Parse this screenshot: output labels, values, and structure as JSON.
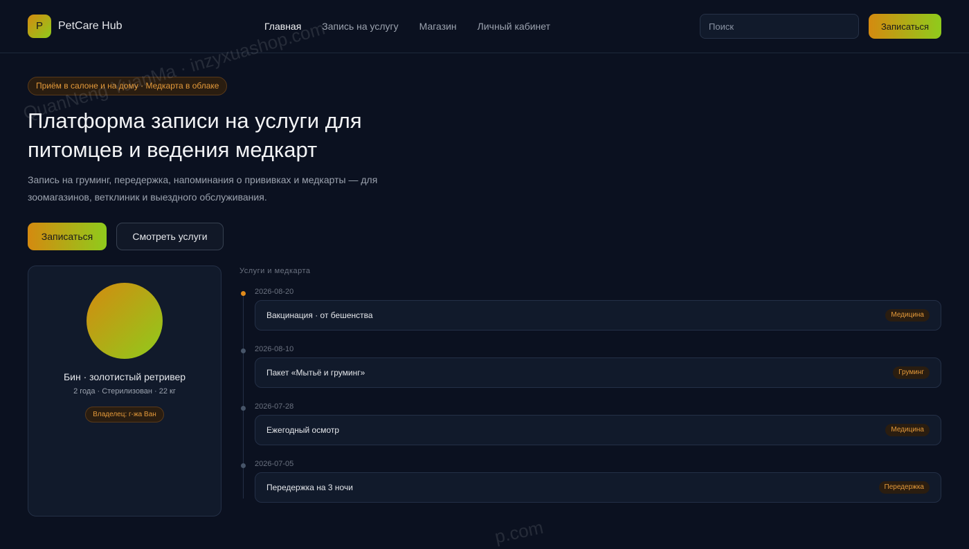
{
  "header": {
    "logo_letter": "P",
    "brand": "PetCare Hub",
    "nav": [
      "Главная",
      "Запись на услугу",
      "Магазин",
      "Личный кабинет"
    ],
    "search_placeholder": "Поиск",
    "cta": "Записаться"
  },
  "hero": {
    "chip": "Приём в салоне и на дому · Медкарта в облаке",
    "title": "Платформа записи на услуги для питомцев и ведения медкарт",
    "subtitle": "Запись на груминг, передержка, напоминания о прививках и медкарты — для зоомагазинов, ветклиник и выездного обслуживания.",
    "primary_button": "Записаться",
    "secondary_button": "Смотреть услуги"
  },
  "pet": {
    "name": "Бин · золотистый ретривер",
    "meta": "2 года · Стерилизован · 22 кг",
    "owner": "Владелец: г-жа Ван"
  },
  "timeline": {
    "title": "Услуги и медкарта",
    "items": [
      {
        "date": "2026-08-20",
        "title": "Вакцинация · от бешенства",
        "tag": "Медицина"
      },
      {
        "date": "2026-08-10",
        "title": "Пакет «Мытьё и груминг»",
        "tag": "Груминг"
      },
      {
        "date": "2026-07-28",
        "title": "Ежегодный осмотр",
        "tag": "Медицина"
      },
      {
        "date": "2026-07-05",
        "title": "Передержка на 3 ночи",
        "tag": "Передержка"
      }
    ]
  },
  "watermark": {
    "line1": "QuanNeng YuanMa · inzyxuashop.com",
    "line2": "p.com"
  },
  "colors": {
    "background": "#0b1120",
    "accent_start": "#d48a10",
    "accent_end": "#8fcb1c",
    "tag_text": "#e59a3a"
  }
}
